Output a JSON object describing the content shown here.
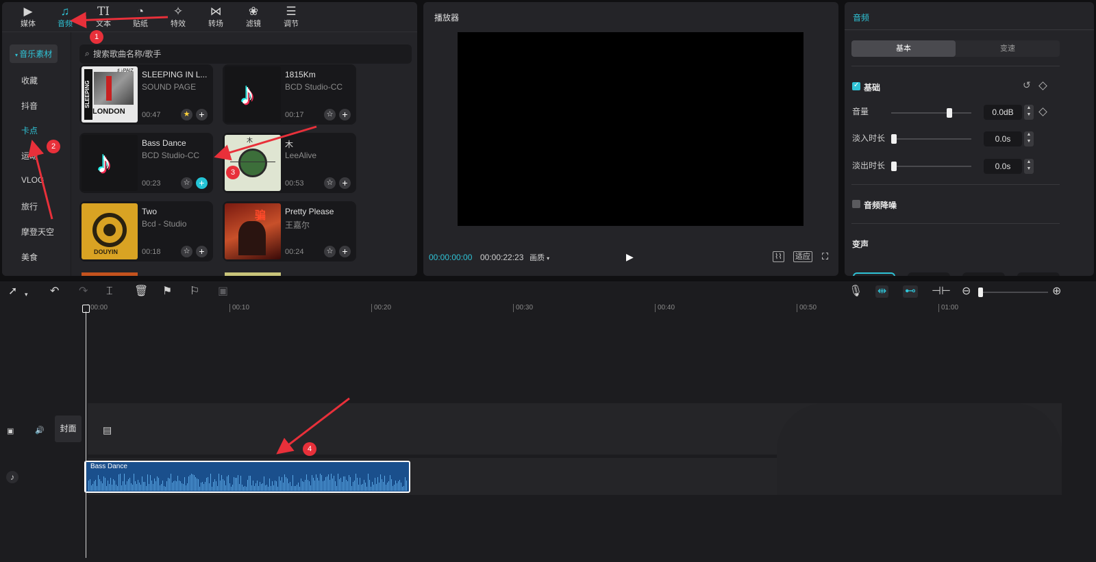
{
  "top_tabs": [
    {
      "label": "媒体",
      "icon": "media-icon"
    },
    {
      "label": "音频",
      "icon": "audio-icon"
    },
    {
      "label": "文本",
      "icon": "text-icon"
    },
    {
      "label": "贴纸",
      "icon": "sticker-icon"
    },
    {
      "label": "特效",
      "icon": "effects-icon"
    },
    {
      "label": "转场",
      "icon": "transition-icon"
    },
    {
      "label": "滤镜",
      "icon": "filter-icon"
    },
    {
      "label": "调节",
      "icon": "adjust-icon"
    }
  ],
  "categories": {
    "header": "音乐素材",
    "items": [
      "收藏",
      "抖音",
      "卡点",
      "运动",
      "VLOG",
      "旅行",
      "摩登天空",
      "美食"
    ],
    "selected": "卡点"
  },
  "search": {
    "placeholder": "搜索歌曲名称/歌手"
  },
  "songs": [
    {
      "title": "SLEEPING IN L...",
      "artist": "SOUND PAGE",
      "duration": "00:47",
      "favorited": true,
      "cover": "SLEEPING IN LONDON"
    },
    {
      "title": "1815Km",
      "artist": "BCD Studio-CC",
      "duration": "00:17",
      "favorited": false
    },
    {
      "title": "Bass Dance",
      "artist": "BCD Studio-CC",
      "duration": "00:23",
      "favorited": false,
      "add_active": true
    },
    {
      "title": "木",
      "artist": "LeeAlive",
      "duration": "00:53",
      "favorited": false
    },
    {
      "title": "Two",
      "artist": "Bcd - Studio",
      "duration": "00:18",
      "favorited": false,
      "cover": "DOUYIN"
    },
    {
      "title": "Pretty Please",
      "artist": "王嘉尔",
      "duration": "00:24",
      "favorited": false
    }
  ],
  "player": {
    "title": "播放器",
    "current_time": "00:00:00:00",
    "total_time": "00:00:22:23",
    "ratio_label": "画质",
    "fit_label": "适应"
  },
  "inspector": {
    "title": "音频",
    "tabs": [
      "基本",
      "变速"
    ],
    "active_tab": "基本",
    "section_basic": "基础",
    "volume": {
      "label": "音量",
      "value": "0.0dB",
      "level": 0.74
    },
    "fade_in": {
      "label": "淡入时长",
      "value": "0.0s",
      "level": 0
    },
    "fade_out": {
      "label": "淡出时长",
      "value": "0.0s",
      "level": 0
    },
    "noise_reduction": "音频降噪",
    "voice_change": "变声"
  },
  "timeline": {
    "ruler": [
      "00:00",
      "00:10",
      "00:20",
      "00:30",
      "00:40",
      "00:50",
      "01:00"
    ],
    "cover_label": "封面",
    "clip_title": "Bass Dance"
  },
  "annotations": [
    "1",
    "2",
    "3",
    "4"
  ],
  "colors": {
    "accent": "#2fc3d6",
    "clip": "#1a4f8c",
    "annotation": "#e8303a"
  }
}
